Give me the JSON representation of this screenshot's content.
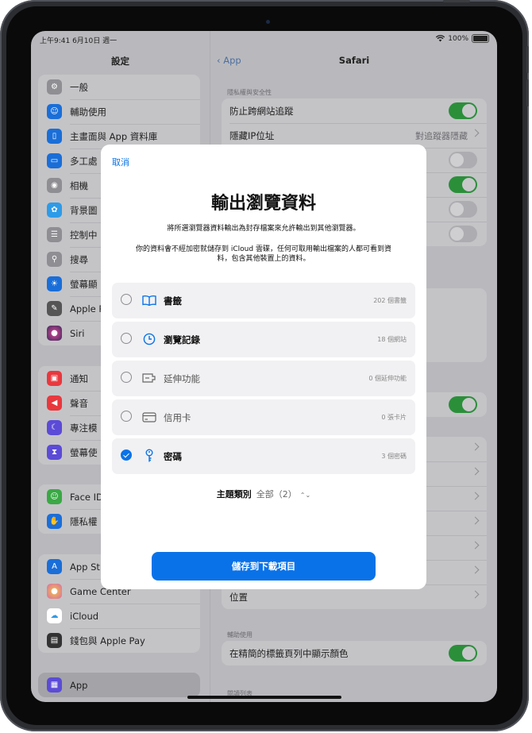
{
  "status_bar": {
    "time": "上午9:41  6月10日 週一",
    "battery": "100%"
  },
  "sidebar": {
    "title": "設定",
    "group1": [
      {
        "label": "一般",
        "icon": "gear-icon",
        "color": "#8e8e93"
      },
      {
        "label": "輔助使用",
        "icon": "accessibility-icon",
        "color": "#1a6ed8"
      },
      {
        "label": "主畫面與 App 資料庫",
        "icon": "home-screen-icon",
        "color": "#1a6ed8"
      },
      {
        "label": "多工處",
        "icon": "multitasking-icon",
        "color": "#1a6ed8"
      },
      {
        "label": "相機",
        "icon": "camera-icon",
        "color": "#8e8e93"
      },
      {
        "label": "背景圖",
        "icon": "wallpaper-icon",
        "color": "#2d9be8"
      },
      {
        "label": "控制中",
        "icon": "control-center-icon",
        "color": "#8e8e93"
      },
      {
        "label": "搜尋",
        "icon": "search-icon",
        "color": "#8e8e93"
      },
      {
        "label": "螢幕顯",
        "icon": "brightness-icon",
        "color": "#1a6ed8"
      },
      {
        "label": "Apple P",
        "icon": "pencil-icon",
        "color": "#555555"
      },
      {
        "label": "Siri",
        "icon": "siri-icon",
        "color": "#3a2a5a"
      }
    ],
    "group2": [
      {
        "label": "通知",
        "icon": "notifications-icon",
        "color": "#e8383d"
      },
      {
        "label": "聲音",
        "icon": "sound-icon",
        "color": "#e8383d"
      },
      {
        "label": "專注模",
        "icon": "focus-icon",
        "color": "#5b4bd6"
      },
      {
        "label": "螢幕使",
        "icon": "screen-time-icon",
        "color": "#5b4bd6"
      }
    ],
    "group3": [
      {
        "label": "Face ID",
        "icon": "face-id-icon",
        "color": "#3aa845"
      },
      {
        "label": "隱私權",
        "icon": "privacy-icon",
        "color": "#1a6ed8"
      }
    ],
    "group4": [
      {
        "label": "App St",
        "icon": "app-store-icon",
        "color": "#1a6ed8"
      },
      {
        "label": "Game Center",
        "icon": "game-center-icon",
        "color": "#d86aa8"
      },
      {
        "label": "iCloud",
        "icon": "icloud-icon",
        "color": "#2d9be8"
      },
      {
        "label": "錢包與 Apple Pay",
        "icon": "wallet-icon",
        "color": "#333333"
      }
    ],
    "selected": {
      "label": "App",
      "icon": "apps-icon",
      "color": "#5b4bd6"
    }
  },
  "detail": {
    "back_label": "App",
    "title": "Safari",
    "privacy_header": "隱私權與安全性",
    "privacy_rows": [
      {
        "label": "防止跨網站追蹤"
      },
      {
        "label": "隱藏IP位址",
        "value": "對追蹤器隱藏"
      }
    ],
    "location_label": "位置",
    "accessibility_header": "輔助使用",
    "accessibility_row": "在精簡的標籤頁列中顯示顏色",
    "reading_list_header": "閱讀列表"
  },
  "modal": {
    "cancel_label": "取消",
    "title": "輸出瀏覽資料",
    "subtitle": "將所選瀏覽器資料輸出為封存檔案來允許輸出到其他瀏覽器。",
    "description": "你的資料會不經加密就儲存到 iCloud 雲碟，任何可取用輸出檔案的人都可看到資料，包含其他裝置上的資料。",
    "items": [
      {
        "label": "書籤",
        "count": "202 個書籤",
        "checked": false,
        "icon": "book-icon"
      },
      {
        "label": "瀏覽記錄",
        "count": "18 個網站",
        "checked": false,
        "icon": "clock-icon"
      },
      {
        "label": "延伸功能",
        "count": "0 個延伸功能",
        "checked": false,
        "icon": "extension-icon"
      },
      {
        "label": "信用卡",
        "count": "0 張卡片",
        "checked": false,
        "icon": "credit-card-icon"
      },
      {
        "label": "密碼",
        "count": "3 個密碼",
        "checked": true,
        "icon": "key-icon"
      }
    ],
    "topic_label": "主題類別",
    "topic_value": "全部（2）",
    "save_label": "儲存到下載項目"
  },
  "colors": {
    "accent": "#0a72e8",
    "toggle_on": "#2b8f3a"
  }
}
